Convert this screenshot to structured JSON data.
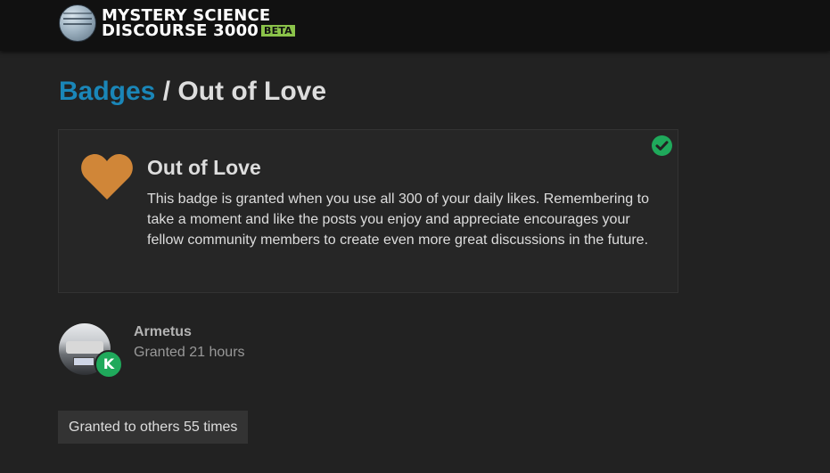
{
  "header": {
    "logo_line1": "MYSTERY SCIENCE",
    "logo_line2": "DISCOURSE 3000",
    "beta_label": "BETA",
    "logo_icon": "globe-logo-icon"
  },
  "breadcrumb": {
    "parent_label": "Badges",
    "separator": " / ",
    "current_label": "Out of Love"
  },
  "badge": {
    "name": "Out of Love",
    "description": "This badge is granted when you use all 300 of your daily likes. Remembering to take a moment and like the posts you enjoy and appreciate encourages your fellow community members to create even more great discussions in the future.",
    "icon": "heart-icon",
    "icon_color": "#d08638",
    "granted_indicator": "check-circle-icon",
    "granted_color": "#1fa95b"
  },
  "grant": {
    "username": "Armetus",
    "time_text": "Granted 21 hours",
    "flair_letter": "K",
    "flair_color": "#1fa95b"
  },
  "others_button_label": "Granted to others 55 times",
  "colors": {
    "background": "#222222",
    "link": "#1a86b8",
    "beta": "#8bc34a"
  }
}
